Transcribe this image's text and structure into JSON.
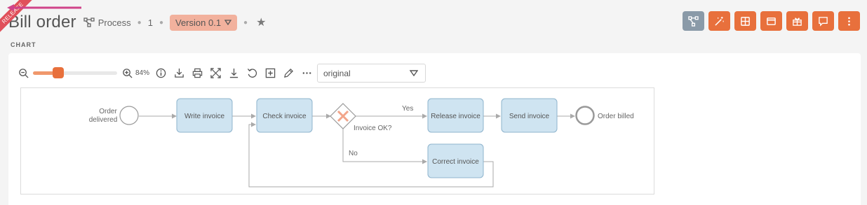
{
  "ribbon": {
    "label": "RELEASE",
    "color": "#e0505a"
  },
  "header": {
    "title": "Bill order",
    "type_label": "Process",
    "number": "1",
    "version_label": "Version 0.1"
  },
  "toolbar": {
    "buttons": [
      "process-diagram-icon",
      "magic-wand-icon",
      "table-icon",
      "window-icon",
      "gift-icon",
      "comment-icon",
      "more-vertical-icon"
    ]
  },
  "section_label": "CHART",
  "chart_tools": {
    "zoom_percent": "84%",
    "zoom_level": 0.84,
    "view_select": {
      "selected": "original"
    }
  },
  "diagram": {
    "start_event": "Order delivered",
    "start_line1": "Order",
    "start_line2": "delivered",
    "tasks": {
      "write": "Write invoice",
      "check": "Check invoice",
      "release": "Release invoice",
      "send": "Send invoice",
      "correct": "Correct invoice"
    },
    "gateway_label": "Invoice OK?",
    "flow_yes": "Yes",
    "flow_no": "No",
    "end_event": "Order billed"
  },
  "colors": {
    "accent": "#e8703c",
    "version_badge": "#f2b19d",
    "task_fill": "#cfe4f1",
    "task_stroke": "#8fb4cd",
    "gateway_x": "#f2a58a",
    "header_gray_button": "#8a9aa8"
  }
}
